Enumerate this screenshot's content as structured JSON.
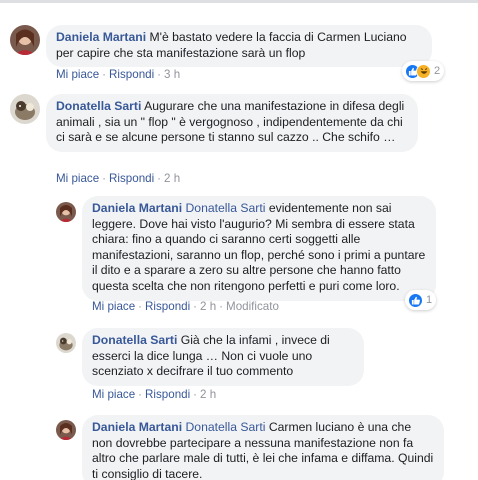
{
  "actions": {
    "like": "Mi piace",
    "reply": "Rispondi",
    "dot": "·"
  },
  "comments": [
    {
      "author": "Daniela Martani",
      "mention": "",
      "text": "M'è bastato vedere la faccia di Carmen Luciano per capire che sta manifestazione sarà un flop",
      "time": "3 h",
      "edited": "",
      "reactions": {
        "icons": [
          "like-icon",
          "haha-icon"
        ],
        "count": "2"
      }
    },
    {
      "author": "Donatella Sarti",
      "mention": "",
      "text": "Augurare che una manifestazione in difesa degli animali , sia un \" flop \" è vergognoso , indipendentemente da chi ci sarà e se alcune persone ti stanno sul cazzo .. Che schifo …",
      "time": "2 h",
      "edited": ""
    },
    {
      "author": "Daniela Martani",
      "mention": "Donatella Sarti",
      "text": "evidentemente non sai leggere. Dove hai visto l'augurio? Mi sembra di essere stata chiara: fino a quando ci saranno certi soggetti alle manifestazioni, saranno un flop, perché sono i primi a puntare il dito e a sparare a zero su altre persone che hanno fatto questa scelta che non ritengono perfetti e puri come loro.",
      "time": "2 h",
      "edited": "Modificato",
      "reactions": {
        "icons": [
          "like-icon"
        ],
        "count": "1"
      }
    },
    {
      "author": "Donatella Sarti",
      "mention": "",
      "text": "Già che la infami , invece di esserci la dice lunga … Non ci vuole uno scenziato x decifrare il tuo commento",
      "time": "2 h",
      "edited": ""
    },
    {
      "author": "Daniela Martani",
      "mention": "Donatella Sarti",
      "text": "Carmen luciano è una che non dovrebbe partecipare a nessuna manifestazione non fa altro che parlare male di tutti, è lei che infama e diffama. Quindi ti consiglio di tacere.",
      "time": "",
      "edited": ""
    }
  ]
}
